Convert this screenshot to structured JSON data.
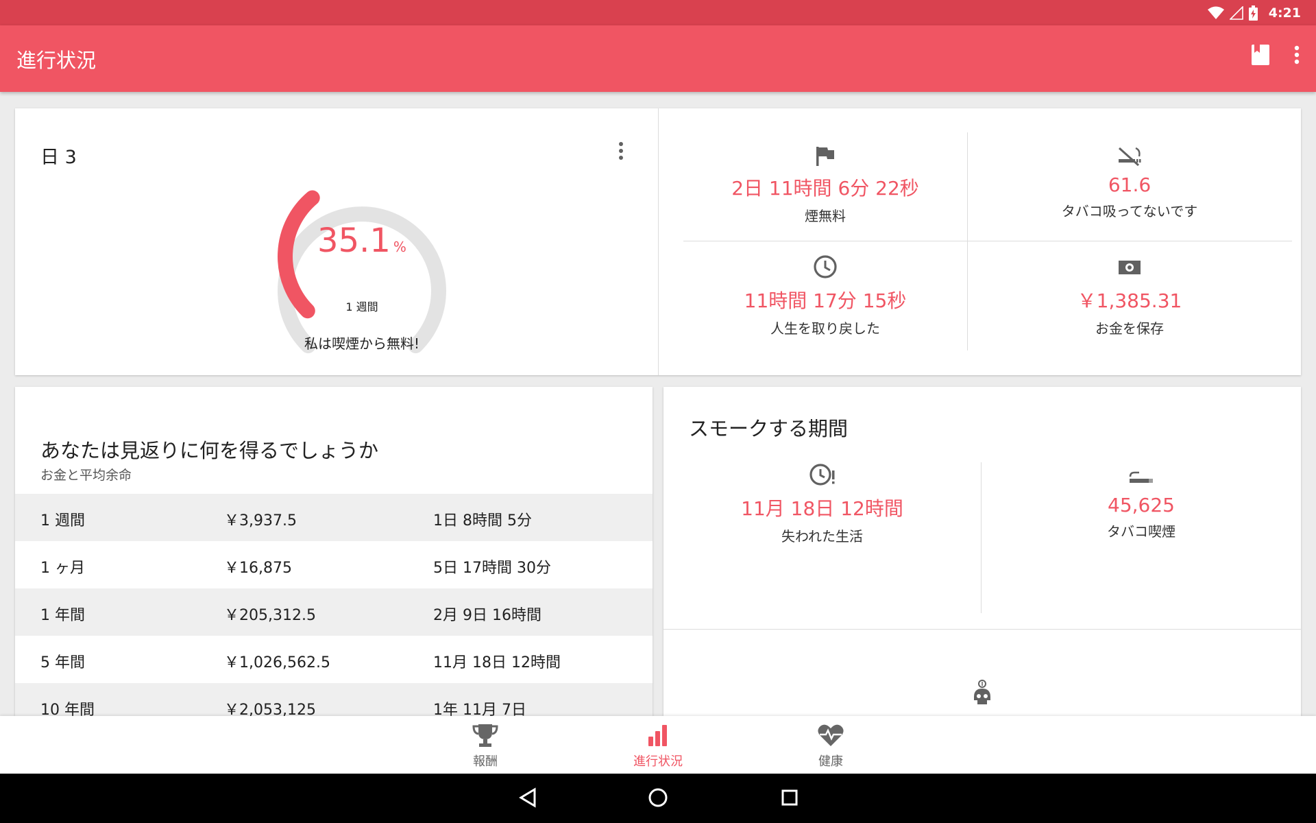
{
  "status_bar": {
    "time": "4:21",
    "icons": [
      "wifi-icon",
      "no-signal-icon",
      "battery-charging-icon"
    ]
  },
  "app_bar": {
    "title": "進行状況",
    "actions": [
      "bookmark-icon",
      "more-vert-icon"
    ]
  },
  "progress_card": {
    "day_title": "日 3",
    "gauge": {
      "percent": "35.1",
      "unit": "%",
      "period": "1 週間",
      "fraction": 0.351
    },
    "caption": "私は喫煙から無料!"
  },
  "stats": [
    {
      "icon": "flag-icon",
      "value": "2日 11時間 6分 22秒",
      "label": "煙無料"
    },
    {
      "icon": "no-smoking-icon",
      "value": "61.6",
      "label": "タバコ吸ってないです"
    },
    {
      "icon": "clock-icon",
      "value": "11時間 17分 15秒",
      "label": "人生を取り戻した"
    },
    {
      "icon": "money-icon",
      "value": "￥1,385.31",
      "label": "お金を保存"
    }
  ],
  "rewards_card": {
    "title": "あなたは見返りに何を得るでしょうか",
    "subtitle": "お金と平均余命",
    "rows": [
      {
        "period": "1 週間",
        "money": "￥3,937.5",
        "life": "1日 8時間 5分"
      },
      {
        "period": "1 ヶ月",
        "money": "￥16,875",
        "life": "5日 17時間 30分"
      },
      {
        "period": "1 年間",
        "money": "￥205,312.5",
        "life": "2月 9日 16時間"
      },
      {
        "period": "5 年間",
        "money": "￥1,026,562.5",
        "life": "11月 18日 12時間"
      },
      {
        "period": "10 年間",
        "money": "￥2,053,125",
        "life": "1年 11月 7日"
      }
    ]
  },
  "smoking_card": {
    "title": "スモークする期間",
    "stats": [
      {
        "icon": "clock-alert-icon",
        "value": "11月 18日 12時間",
        "label": "失われた生活"
      },
      {
        "icon": "cigarette-icon",
        "value": "45,625",
        "label": "タバコ喫煙"
      }
    ],
    "bottom_icon": "skull-money-icon"
  },
  "bottom_nav": [
    {
      "icon": "trophy-icon",
      "label": "報酬",
      "active": false
    },
    {
      "icon": "bar-chart-icon",
      "label": "進行状況",
      "active": true
    },
    {
      "icon": "heart-pulse-icon",
      "label": "健康",
      "active": false
    }
  ],
  "colors": {
    "status_bar": "#d9414f",
    "primary": "#f05563",
    "inactive": "#666666"
  }
}
